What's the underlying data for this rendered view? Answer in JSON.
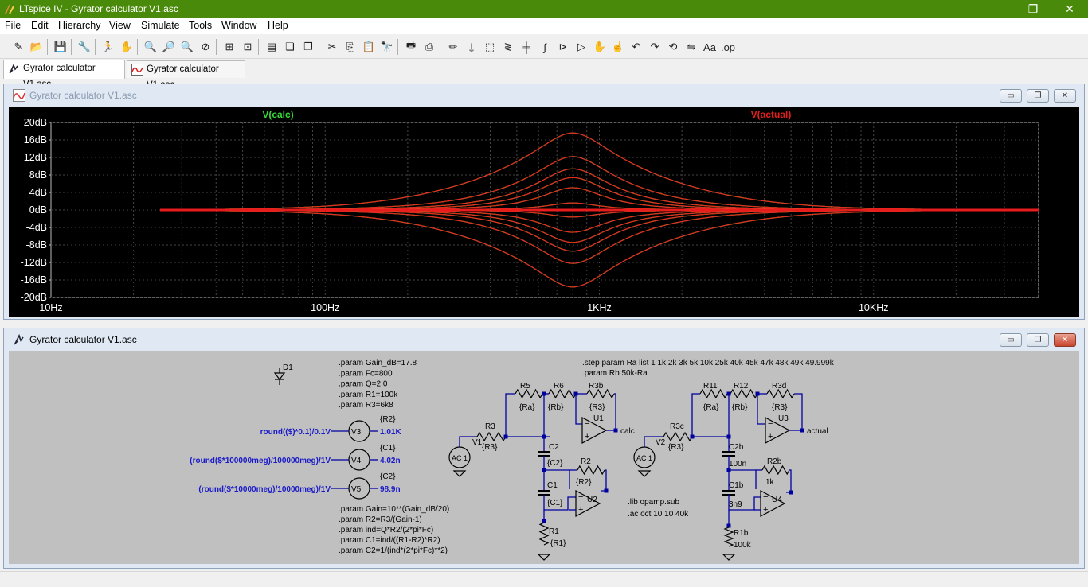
{
  "window": {
    "title": "LTspice IV - Gyrator calculator V1.asc",
    "minimize": "—",
    "maximize": "❐",
    "close": "✕"
  },
  "menu": [
    "File",
    "Edit",
    "Hierarchy",
    "View",
    "Simulate",
    "Tools",
    "Window",
    "Help"
  ],
  "toolbar": [
    {
      "icon": "new-schematic-icon",
      "glyph": "✎"
    },
    {
      "icon": "open-icon",
      "glyph": "📂"
    },
    {
      "sep": true
    },
    {
      "icon": "save-icon",
      "glyph": "💾"
    },
    {
      "sep": true
    },
    {
      "icon": "control-panel-icon",
      "glyph": "🔧"
    },
    {
      "sep": true
    },
    {
      "icon": "run-icon",
      "glyph": "🏃"
    },
    {
      "icon": "halt-icon",
      "glyph": "✋"
    },
    {
      "sep": true
    },
    {
      "icon": "zoom-in-icon",
      "glyph": "🔍"
    },
    {
      "icon": "pan-icon",
      "glyph": "🔎"
    },
    {
      "icon": "zoom-out-icon",
      "glyph": "🔍"
    },
    {
      "icon": "zoom-fit-icon",
      "glyph": "⊘"
    },
    {
      "sep": true
    },
    {
      "icon": "autorange-icon",
      "glyph": "⊞"
    },
    {
      "icon": "mark-unref-icon",
      "glyph": "⊡"
    },
    {
      "sep": true
    },
    {
      "icon": "tile-horizontal-icon",
      "glyph": "▤"
    },
    {
      "icon": "cascade-icon",
      "glyph": "❏"
    },
    {
      "icon": "tile-vertical-icon",
      "glyph": "❐"
    },
    {
      "sep": true
    },
    {
      "icon": "cut-icon",
      "glyph": "✂"
    },
    {
      "icon": "copy-icon",
      "glyph": "⎘"
    },
    {
      "icon": "paste-icon",
      "glyph": "📋"
    },
    {
      "icon": "find-icon",
      "glyph": "🔭"
    },
    {
      "sep": true
    },
    {
      "icon": "print-preview-icon",
      "glyph": "🖶"
    },
    {
      "icon": "print-icon",
      "glyph": "⎙"
    },
    {
      "sep": true
    },
    {
      "icon": "draw-wire-icon",
      "glyph": "✏"
    },
    {
      "icon": "ground-icon",
      "glyph": "⏚"
    },
    {
      "icon": "label-net-icon",
      "glyph": "⬚"
    },
    {
      "icon": "resistor-icon",
      "glyph": "≷"
    },
    {
      "icon": "capacitor-icon",
      "glyph": "╪"
    },
    {
      "icon": "inductor-icon",
      "glyph": "∫"
    },
    {
      "icon": "diode-icon",
      "glyph": "⊳"
    },
    {
      "icon": "component-icon",
      "glyph": "▷"
    },
    {
      "icon": "move-icon",
      "glyph": "✋"
    },
    {
      "icon": "drag-icon",
      "glyph": "☝"
    },
    {
      "icon": "undo-icon",
      "glyph": "↶"
    },
    {
      "icon": "redo-icon",
      "glyph": "↷"
    },
    {
      "icon": "rotate-icon",
      "glyph": "⟲"
    },
    {
      "icon": "mirror-icon",
      "glyph": "⇋"
    },
    {
      "icon": "text-icon",
      "glyph": "Aa"
    },
    {
      "icon": "spice-directive-icon",
      "glyph": ".op"
    }
  ],
  "tabs": [
    {
      "label": "Gyrator calculator V1.asc",
      "kind": "schematic"
    },
    {
      "label": "Gyrator calculator V1.asc",
      "kind": "waveform"
    }
  ],
  "plot_window": {
    "title": "Gyrator calculator V1.asc"
  },
  "schematic_window": {
    "title": "Gyrator calculator V1.asc"
  },
  "chart_data": {
    "type": "line",
    "xscale": "log",
    "xlim": [
      10,
      40000
    ],
    "ylim": [
      -20,
      20
    ],
    "xticks": [
      "10Hz",
      "100Hz",
      "1KHz",
      "10KHz"
    ],
    "yticks": [
      "20dB",
      "16dB",
      "12dB",
      "8dB",
      "4dB",
      "0dB",
      "-4dB",
      "-8dB",
      "-12dB",
      "-16dB",
      "-20dB"
    ],
    "grid": true,
    "legend": [
      {
        "name": "V(calc)",
        "color": "#37d937"
      },
      {
        "name": "V(actual)",
        "color": "#e81c1c"
      }
    ],
    "center_freq": 800,
    "q": 2.0,
    "peak_gains_db": [
      17.6,
      12.2,
      9.4,
      7.4,
      5.1,
      1.6,
      -1.6,
      -5.1,
      -7.4,
      -9.4,
      -12.2,
      -17.6
    ],
    "background": "#000000",
    "grid_color": "#444444",
    "axis_label_color": "#ffffff"
  },
  "schematic": {
    "text_color": "#000000",
    "wire_color": "#0000a0",
    "blue_text_color": "#1a1ac8",
    "params_top": [
      ".param Gain_dB=17.8",
      ".param Fc=800",
      ".param Q=2.0",
      ".param R1=100k",
      ".param R3=6k8"
    ],
    "params_step": [
      ".step param Ra list 1 1k 2k 3k  5k 10k 25k 40k 45k 47k 48k 49k 49.999k",
      ".param Rb 50k-Ra"
    ],
    "params_bottom": [
      ".param Gain=10**(Gain_dB/20)",
      ".param R2=R3/(Gain-1)",
      ".param ind=Q*R2/(2*pi*Fc)",
      ".param C1=ind/((R1-R2)*R2)",
      ".param C2=1/(ind*(2*pi*Fc)**2)"
    ],
    "lib_lines": [
      ".lib opamp.sub",
      ".ac oct 10 10 40k"
    ],
    "meters": [
      {
        "expr": "round(($)*0.1)/0.1V",
        "name": "V3",
        "param": "{R2}",
        "value": "1.01K"
      },
      {
        "expr": "(round($*100000meg)/100000meg)/1V",
        "name": "V4",
        "param": "{C1}",
        "value": "4.02n"
      },
      {
        "expr": "(round($*10000meg)/10000meg)/1V",
        "name": "V5",
        "param": "{C2}",
        "value": "98.9n"
      }
    ],
    "diode": "D1",
    "labels": {
      "R5": "R5",
      "R6": "R6",
      "R3b": "R3b",
      "Ra": "{Ra}",
      "Rb": "{Rb}",
      "R3val": "{R3}",
      "R3": "R3",
      "V1": "V1",
      "U1": "U1",
      "calc": "calc",
      "C2": "C2",
      "C2val": "{C2}",
      "R2": "R2",
      "R2val": "{R2}",
      "C1": "C1",
      "C1val": "{C1}",
      "U2": "U2",
      "R1": "R1",
      "R1val": "{R1}",
      "AC1": "AC 1",
      "AC1b": "AC 1",
      "R11": "R11",
      "R12": "R12",
      "R3d": "R3d",
      "R3c": "R3c",
      "V2": "V2",
      "U3": "U3",
      "actual": "actual",
      "C2b": "C2b",
      "C2bval": "100n",
      "R2b": "R2b",
      "R2bval": "1k",
      "C1b": "C1b",
      "C1bval": "3n9",
      "U4": "U4",
      "R1b": "R1b",
      "R1bval": "100k"
    }
  }
}
